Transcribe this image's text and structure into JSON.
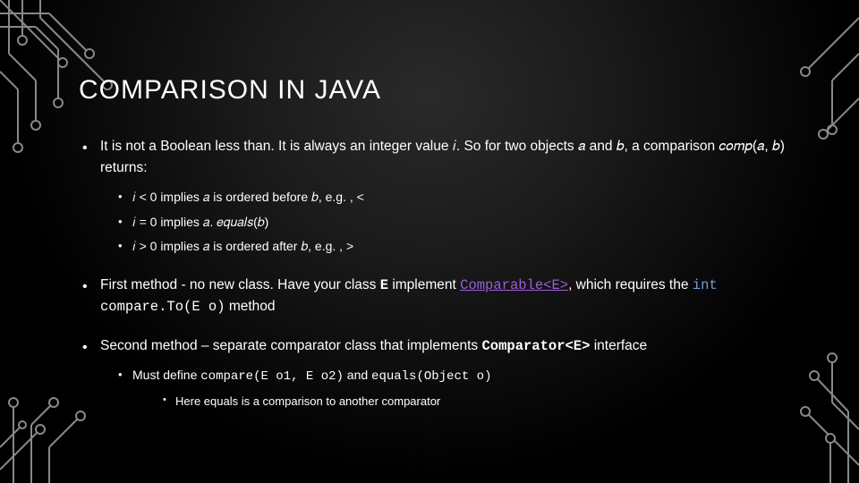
{
  "title": "COMPARISON IN JAVA",
  "b1": {
    "text": "It is not a Boolean less than. It is always an integer value 𝑖. So for two objects 𝑎 and 𝑏, a comparison 𝑐𝑜𝑚𝑝(𝑎, 𝑏) returns:",
    "s1": "𝑖 < 0 implies 𝑎 is ordered before 𝑏, e.g. , <",
    "s2": "𝑖 = 0 implies 𝑎. 𝑒𝑞𝑢𝑎𝑙𝑠(𝑏)",
    "s3": "𝑖 > 0 implies 𝑎 is ordered after 𝑏, e.g. , >"
  },
  "b2": {
    "pre": "First method - no new class. Have your class ",
    "classE": "E",
    "mid1": " implement ",
    "link": "Comparable<E>",
    "mid2": ", which requires the ",
    "kw": "int",
    "method": " compare.To(E o)",
    "tail": " method"
  },
  "b3": {
    "pre": "Second method – separate comparator class that implements ",
    "comp": "Comparator<E>",
    "post": " interface",
    "s1": {
      "pre": "Must define ",
      "m1": "compare(E o1, E o2)",
      "mid": " and ",
      "m2": "equals(Object o)"
    },
    "s2": "Here equals is a comparison to another comparator"
  }
}
